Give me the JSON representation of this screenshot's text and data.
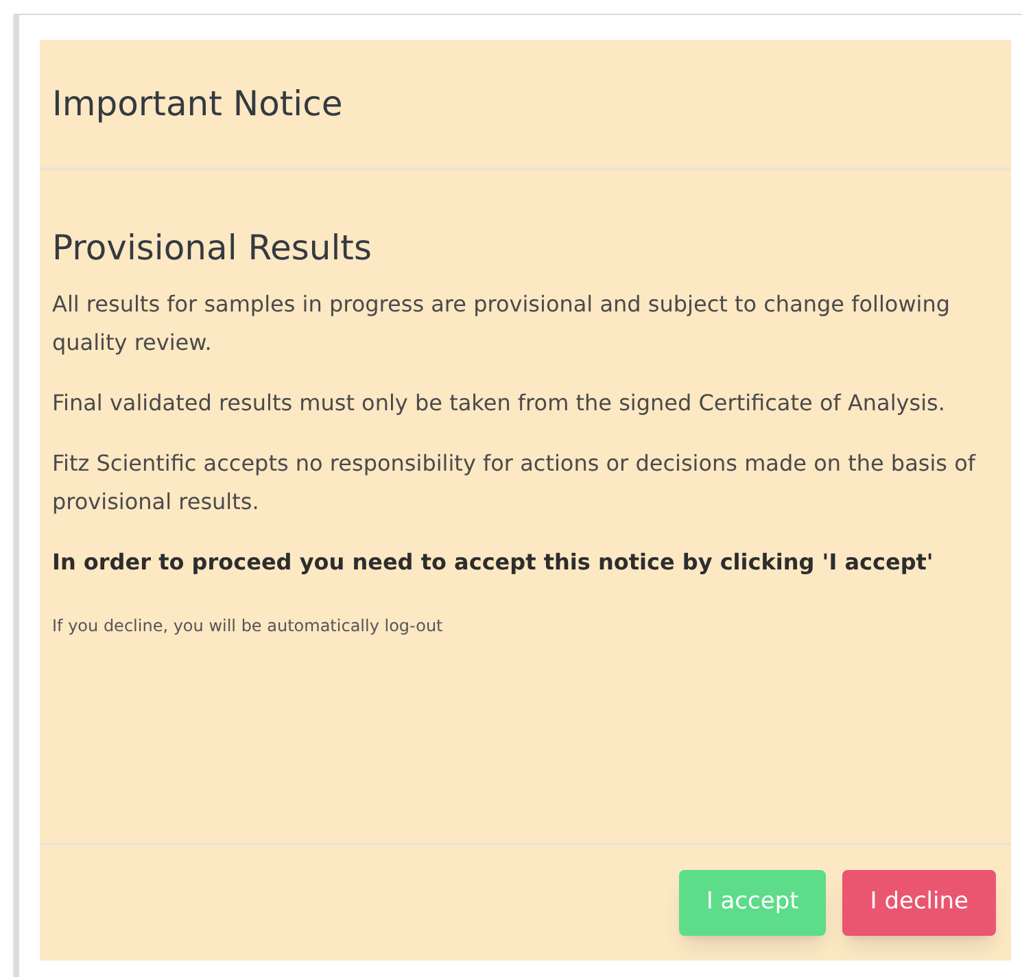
{
  "dialog": {
    "title": "Important Notice",
    "heading": "Provisional Results",
    "paragraphs": [
      {
        "kind": "normal",
        "text": "All results for samples in progress are provisional and subject to change following quality review."
      },
      {
        "kind": "normal",
        "text": "Final validated results must only be taken from the signed Certificate of Analysis."
      },
      {
        "kind": "normal",
        "text": "Fitz Scientific accepts no responsibility for actions or decisions made on the basis of provisional results."
      },
      {
        "kind": "strong",
        "text": "In order to proceed you need to accept this notice by clicking 'I accept'"
      },
      {
        "kind": "small",
        "text": "If you decline, you will be automatically log-out"
      }
    ],
    "buttons": [
      {
        "kind": "accept",
        "label": "I accept"
      },
      {
        "kind": "decline",
        "label": "I decline"
      }
    ]
  }
}
